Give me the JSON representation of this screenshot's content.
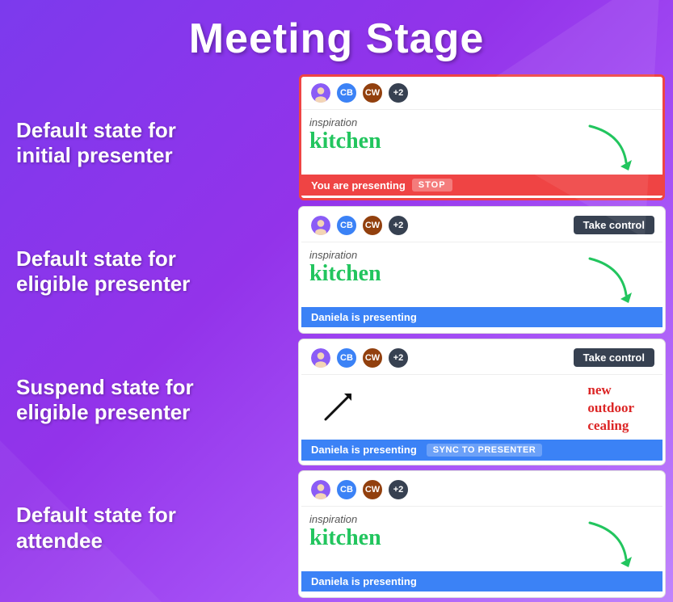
{
  "page": {
    "title": "Meeting Stage"
  },
  "labels": [
    {
      "id": "label-1",
      "line1": "Default state for",
      "line2": "initial presenter"
    },
    {
      "id": "label-2",
      "line1": "Default state for",
      "line2": "eligible presenter"
    },
    {
      "id": "label-3",
      "line1": "Suspend state for",
      "line2": "eligible presenter"
    },
    {
      "id": "label-4",
      "line1": "Default state for",
      "line2": "attendee"
    }
  ],
  "panels": [
    {
      "id": "panel-1",
      "type": "initial-presenter",
      "avatars": [
        {
          "type": "photo",
          "color": "#8b5cf6"
        },
        {
          "type": "initials",
          "text": "CB",
          "color": "#3b82f6"
        },
        {
          "type": "initials",
          "text": "CW",
          "color": "#92400e"
        },
        {
          "type": "plus",
          "text": "+2"
        }
      ],
      "hasTakeControl": false,
      "content": {
        "inspiration": "inspiration",
        "kitchen": "kitchen",
        "hasArrow": true
      },
      "bar": {
        "text": "You are presenting",
        "type": "red",
        "hasStop": true,
        "stopLabel": "STOP"
      }
    },
    {
      "id": "panel-2",
      "type": "eligible-presenter",
      "avatars": [
        {
          "type": "photo",
          "color": "#8b5cf6"
        },
        {
          "type": "initials",
          "text": "CB",
          "color": "#3b82f6"
        },
        {
          "type": "initials",
          "text": "CW",
          "color": "#92400e"
        },
        {
          "type": "plus",
          "text": "+2"
        }
      ],
      "hasTakeControl": true,
      "takeControlLabel": "Take control",
      "content": {
        "inspiration": "inspiration",
        "kitchen": "kitchen",
        "hasArrow": true
      },
      "bar": {
        "text": "Daniela is presenting",
        "type": "blue",
        "hasStop": false
      }
    },
    {
      "id": "panel-3",
      "type": "suspend-eligible",
      "avatars": [
        {
          "type": "photo",
          "color": "#8b5cf6"
        },
        {
          "type": "initials",
          "text": "CB",
          "color": "#3b82f6"
        },
        {
          "type": "initials",
          "text": "CW",
          "color": "#92400e"
        },
        {
          "type": "plus",
          "text": "+2"
        }
      ],
      "hasTakeControl": true,
      "takeControlLabel": "Take control",
      "content": {
        "hasArrow": false,
        "hasDiagonalArrow": true,
        "handwriting": "new\noutdoor\ncealing"
      },
      "bar": {
        "text": "Daniela is presenting",
        "type": "blue",
        "hasSync": true,
        "syncLabel": "SYNC TO PRESENTER"
      }
    },
    {
      "id": "panel-4",
      "type": "attendee",
      "avatars": [
        {
          "type": "photo",
          "color": "#8b5cf6"
        },
        {
          "type": "initials",
          "text": "CB",
          "color": "#3b82f6"
        },
        {
          "type": "initials",
          "text": "CW",
          "color": "#92400e"
        },
        {
          "type": "plus",
          "text": "+2"
        }
      ],
      "hasTakeControl": false,
      "content": {
        "inspiration": "inspiration",
        "kitchen": "kitchen",
        "hasArrow": true
      },
      "bar": {
        "text": "Daniela is presenting",
        "type": "blue",
        "hasStop": false
      }
    }
  ]
}
